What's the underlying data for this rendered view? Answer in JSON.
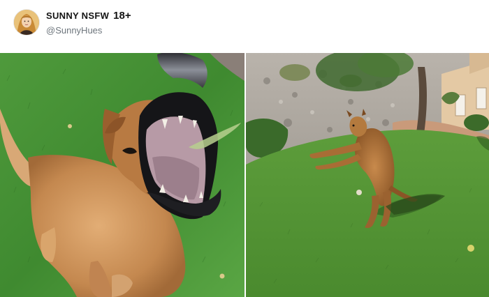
{
  "post": {
    "author": {
      "display_name": "SUNNY NSFW",
      "age_badge": "18+",
      "handle": "@SunnyHues"
    },
    "media": [
      {
        "kind": "photo",
        "subject": "golden dog leaping with open mouth on grass"
      },
      {
        "kind": "photo",
        "subject": "dog jumping in yard with rocky hillside and tree"
      }
    ]
  }
}
